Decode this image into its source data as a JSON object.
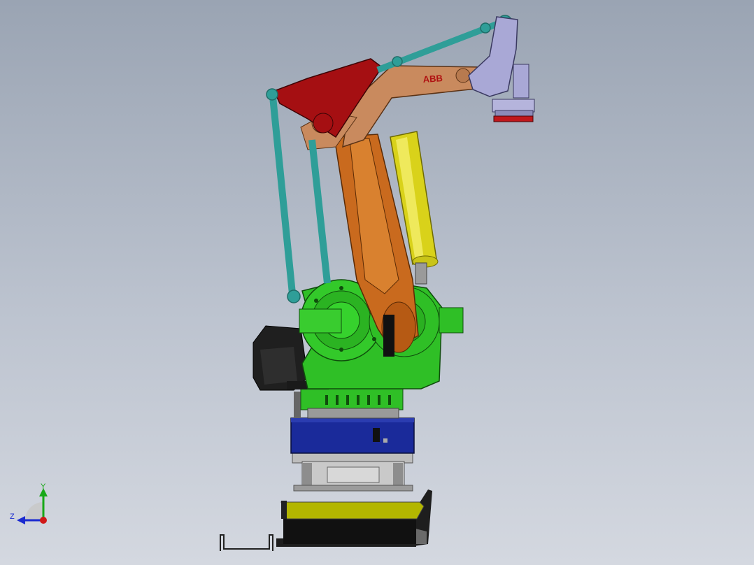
{
  "viewport": {
    "background_top": "#9aa4b3",
    "background_bottom": "#d4d8e0"
  },
  "model": {
    "brand_label": "ABB",
    "parts": {
      "upper_arm": "#c98a5e",
      "lower_arm": "#c96a1e",
      "red_link": "#a50f12",
      "teal_rods": "#2f9e98",
      "yellow_cylinder": "#d9d21a",
      "base_body": "#2fbf26",
      "motor_block": "#1f1f1f",
      "turntable_plate": "#1a2a9a",
      "frame_grey": "#b8b8b8",
      "pallet_yellow": "#b8b800",
      "wrist_lavender": "#a9a8d6",
      "flange_red": "#c0171b"
    }
  },
  "triad": {
    "y_label": "Y",
    "z_label": "Z",
    "colors": {
      "y": "#18a818",
      "z": "#1a2ad0",
      "x": "#d01818"
    }
  }
}
